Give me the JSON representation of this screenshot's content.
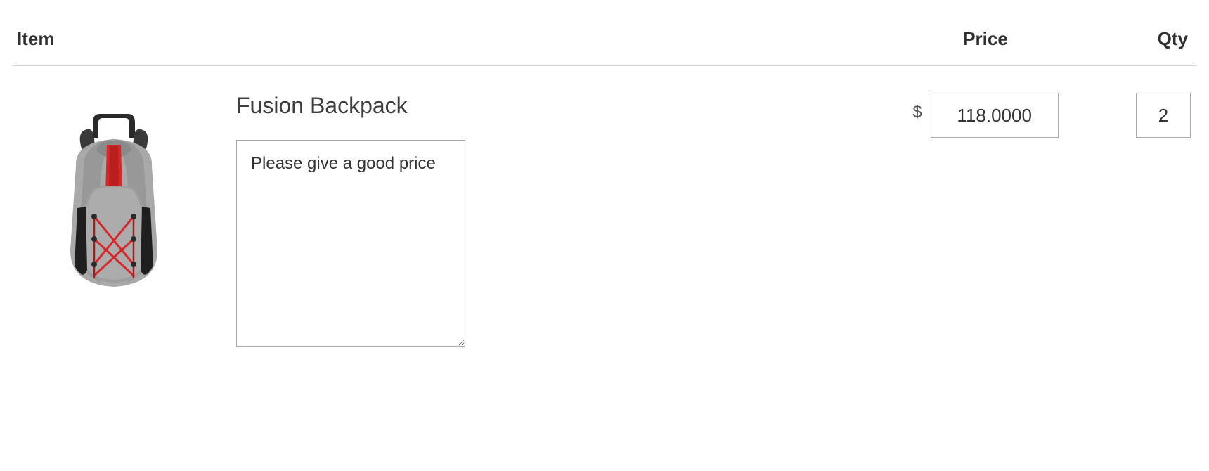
{
  "headers": {
    "item": "Item",
    "price": "Price",
    "qty": "Qty"
  },
  "row": {
    "product_name": "Fusion Backpack",
    "note": "Please give a good price",
    "currency": "$",
    "price": "118.0000",
    "qty": "2"
  }
}
